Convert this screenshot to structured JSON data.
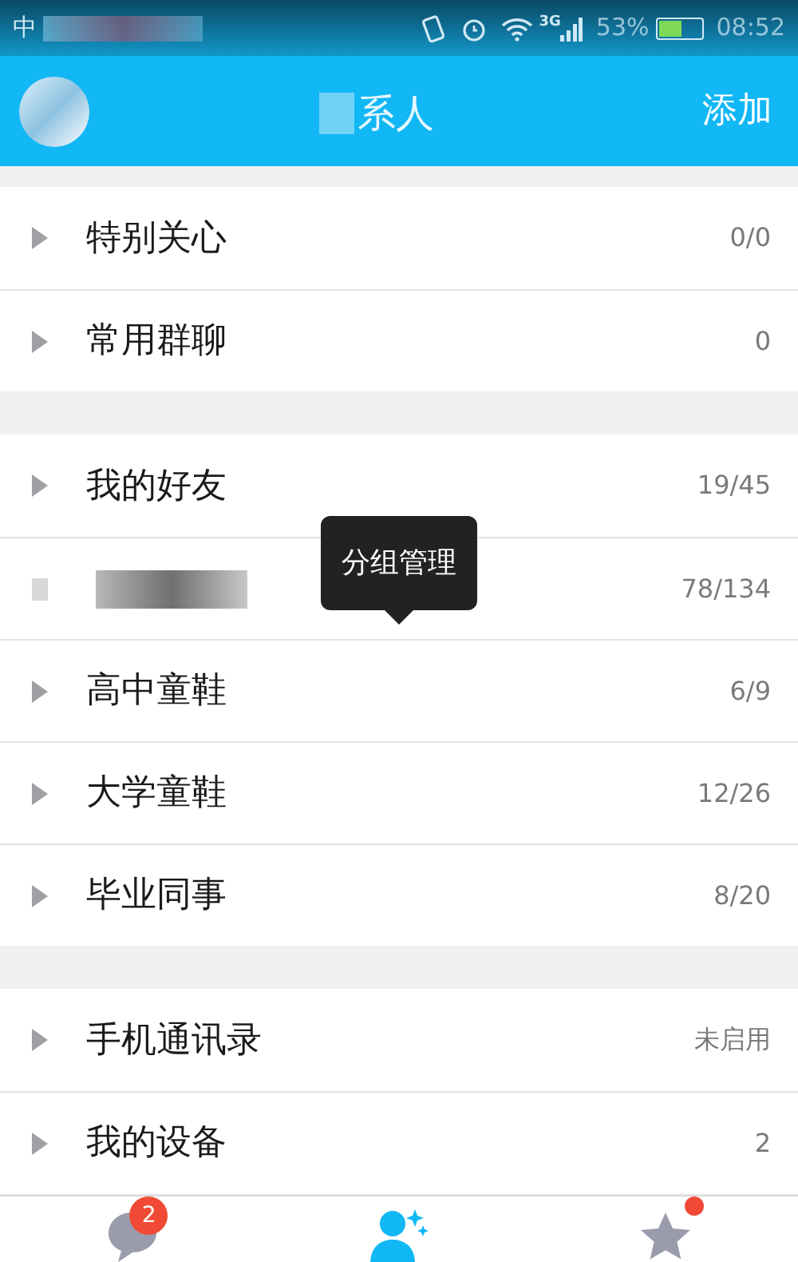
{
  "status_bar": {
    "carrier": "中",
    "network": "3G",
    "battery_percent": "53%",
    "time": "08:52"
  },
  "header": {
    "title": "系人",
    "action": "添加"
  },
  "sections": [
    {
      "rows": [
        {
          "kind": "group",
          "name": "特别关心",
          "count": "0/0"
        },
        {
          "kind": "group",
          "name": "常用群聊",
          "count": "0"
        }
      ]
    },
    {
      "rows": [
        {
          "kind": "group",
          "name": "我的好友",
          "count": "19/45"
        },
        {
          "kind": "obscured",
          "count": "78/134"
        },
        {
          "kind": "group",
          "name": "高中童鞋",
          "count": "6/9"
        },
        {
          "kind": "group",
          "name": "大学童鞋",
          "count": "12/26"
        },
        {
          "kind": "group",
          "name": "毕业同事",
          "count": "8/20"
        }
      ]
    },
    {
      "rows": [
        {
          "kind": "group",
          "name": "手机通讯录",
          "count": "未启用"
        },
        {
          "kind": "group",
          "name": "我的设备",
          "count": "2"
        }
      ]
    }
  ],
  "tooltip": {
    "text": "分组管理"
  },
  "tabs": [
    {
      "kind": "messages",
      "selected": false,
      "badge": "2"
    },
    {
      "kind": "contacts",
      "selected": true
    },
    {
      "kind": "favorites",
      "selected": false,
      "dot": true
    }
  ]
}
